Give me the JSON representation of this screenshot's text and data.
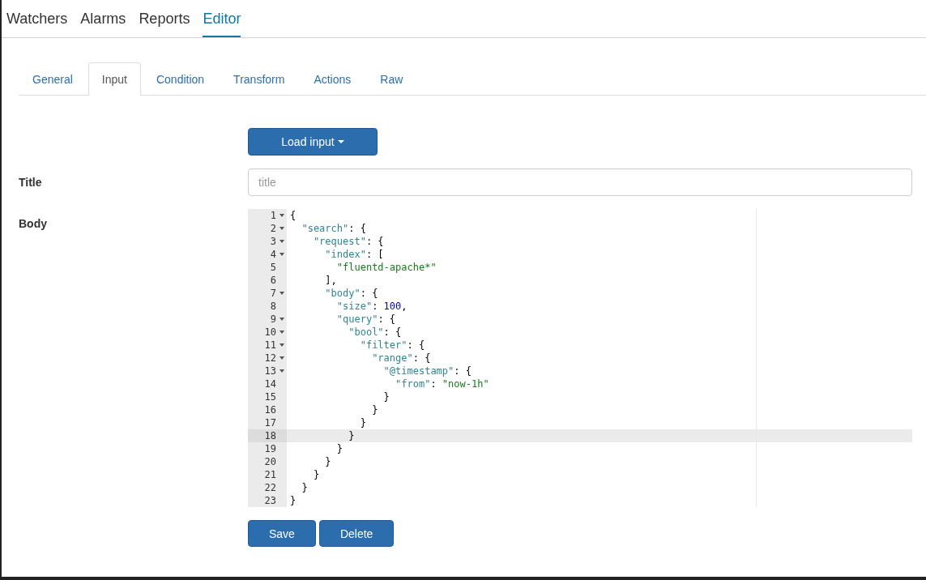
{
  "nav": [
    {
      "label": "Watchers",
      "selected": false
    },
    {
      "label": "Alarms",
      "selected": false
    },
    {
      "label": "Reports",
      "selected": false
    },
    {
      "label": "Editor",
      "selected": true
    }
  ],
  "tabs": [
    {
      "label": "General",
      "selected": false
    },
    {
      "label": "Input",
      "selected": true
    },
    {
      "label": "Condition",
      "selected": false
    },
    {
      "label": "Transform",
      "selected": false
    },
    {
      "label": "Actions",
      "selected": false
    },
    {
      "label": "Raw",
      "selected": false
    }
  ],
  "load_button": {
    "label": "Load input"
  },
  "title_field": {
    "label": "Title",
    "placeholder": "title"
  },
  "body": {
    "label": "Body",
    "lines": [
      {
        "number": "1",
        "fold": true,
        "active": false,
        "tokens": [
          {
            "kind": "punct",
            "text": "{"
          }
        ]
      },
      {
        "number": "2",
        "fold": true,
        "active": false,
        "tokens": [
          {
            "kind": "key",
            "text": "  \"search\""
          },
          {
            "kind": "punct",
            "text": ": {"
          }
        ]
      },
      {
        "number": "3",
        "fold": true,
        "active": false,
        "tokens": [
          {
            "kind": "key",
            "text": "    \"request\""
          },
          {
            "kind": "punct",
            "text": ": {"
          }
        ]
      },
      {
        "number": "4",
        "fold": true,
        "active": false,
        "tokens": [
          {
            "kind": "key",
            "text": "      \"index\""
          },
          {
            "kind": "punct",
            "text": ": ["
          }
        ]
      },
      {
        "number": "5",
        "fold": false,
        "active": false,
        "tokens": [
          {
            "kind": "string",
            "text": "        \"fluentd-apache*\""
          }
        ]
      },
      {
        "number": "6",
        "fold": false,
        "active": false,
        "tokens": [
          {
            "kind": "punct",
            "text": "      ],"
          }
        ]
      },
      {
        "number": "7",
        "fold": true,
        "active": false,
        "tokens": [
          {
            "kind": "key",
            "text": "      \"body\""
          },
          {
            "kind": "punct",
            "text": ": {"
          }
        ]
      },
      {
        "number": "8",
        "fold": false,
        "active": false,
        "tokens": [
          {
            "kind": "key",
            "text": "        \"size\""
          },
          {
            "kind": "punct",
            "text": ": "
          },
          {
            "kind": "number",
            "text": "100"
          },
          {
            "kind": "punct",
            "text": ","
          }
        ]
      },
      {
        "number": "9",
        "fold": true,
        "active": false,
        "tokens": [
          {
            "kind": "key",
            "text": "        \"query\""
          },
          {
            "kind": "punct",
            "text": ": {"
          }
        ]
      },
      {
        "number": "10",
        "fold": true,
        "active": false,
        "tokens": [
          {
            "kind": "key",
            "text": "          \"bool\""
          },
          {
            "kind": "punct",
            "text": ": {"
          }
        ]
      },
      {
        "number": "11",
        "fold": true,
        "active": false,
        "tokens": [
          {
            "kind": "key",
            "text": "            \"filter\""
          },
          {
            "kind": "punct",
            "text": ": {"
          }
        ]
      },
      {
        "number": "12",
        "fold": true,
        "active": false,
        "tokens": [
          {
            "kind": "key",
            "text": "              \"range\""
          },
          {
            "kind": "punct",
            "text": ": {"
          }
        ]
      },
      {
        "number": "13",
        "fold": true,
        "active": false,
        "tokens": [
          {
            "kind": "key",
            "text": "                \"@timestamp\""
          },
          {
            "kind": "punct",
            "text": ": {"
          }
        ]
      },
      {
        "number": "14",
        "fold": false,
        "active": false,
        "tokens": [
          {
            "kind": "key",
            "text": "                  \"from\""
          },
          {
            "kind": "punct",
            "text": ": "
          },
          {
            "kind": "string",
            "text": "\"now-1h\""
          }
        ]
      },
      {
        "number": "15",
        "fold": false,
        "active": false,
        "tokens": [
          {
            "kind": "punct",
            "text": "                }"
          }
        ]
      },
      {
        "number": "16",
        "fold": false,
        "active": false,
        "tokens": [
          {
            "kind": "punct",
            "text": "              }"
          }
        ]
      },
      {
        "number": "17",
        "fold": false,
        "active": false,
        "tokens": [
          {
            "kind": "punct",
            "text": "            }"
          }
        ]
      },
      {
        "number": "18",
        "fold": false,
        "active": true,
        "tokens": [
          {
            "kind": "punct",
            "text": "          }"
          }
        ]
      },
      {
        "number": "19",
        "fold": false,
        "active": false,
        "tokens": [
          {
            "kind": "punct",
            "text": "        }"
          }
        ]
      },
      {
        "number": "20",
        "fold": false,
        "active": false,
        "tokens": [
          {
            "kind": "punct",
            "text": "      }"
          }
        ]
      },
      {
        "number": "21",
        "fold": false,
        "active": false,
        "tokens": [
          {
            "kind": "punct",
            "text": "    }"
          }
        ]
      },
      {
        "number": "22",
        "fold": false,
        "active": false,
        "tokens": [
          {
            "kind": "punct",
            "text": "  }"
          }
        ]
      },
      {
        "number": "23",
        "fold": false,
        "active": false,
        "tokens": [
          {
            "kind": "punct",
            "text": "}"
          }
        ]
      }
    ]
  },
  "buttons": [
    {
      "label": "Save"
    },
    {
      "label": "Delete"
    }
  ]
}
